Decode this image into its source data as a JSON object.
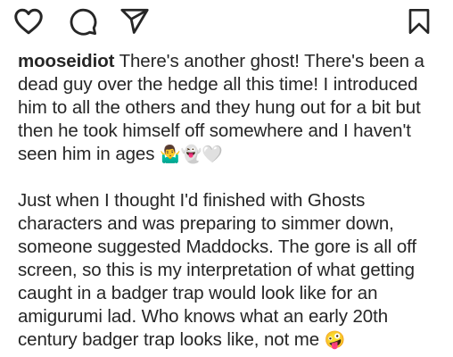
{
  "actions": {
    "icons": [
      "heart-icon",
      "comment-icon",
      "share-icon",
      "bookmark-icon"
    ]
  },
  "post": {
    "username": "mooseidiot",
    "caption_p1": "There's another ghost! There's been a dead guy over the hedge all this time! I introduced him to all the others and they hung out for a bit but then he took himself off somewhere and I haven't seen him in ages",
    "caption_p1_emojis": "🤷‍♂️👻🤍",
    "caption_p2": "Just when I thought I'd finished with Ghosts characters and was preparing to simmer down, someone suggested Maddocks. The gore is all off screen, so this is my interpretation of what getting caught in a badger trap would look like for an amigurumi lad. Who knows what an early 20th century badger trap looks like, not me",
    "caption_p2_emoji": "🤪"
  }
}
